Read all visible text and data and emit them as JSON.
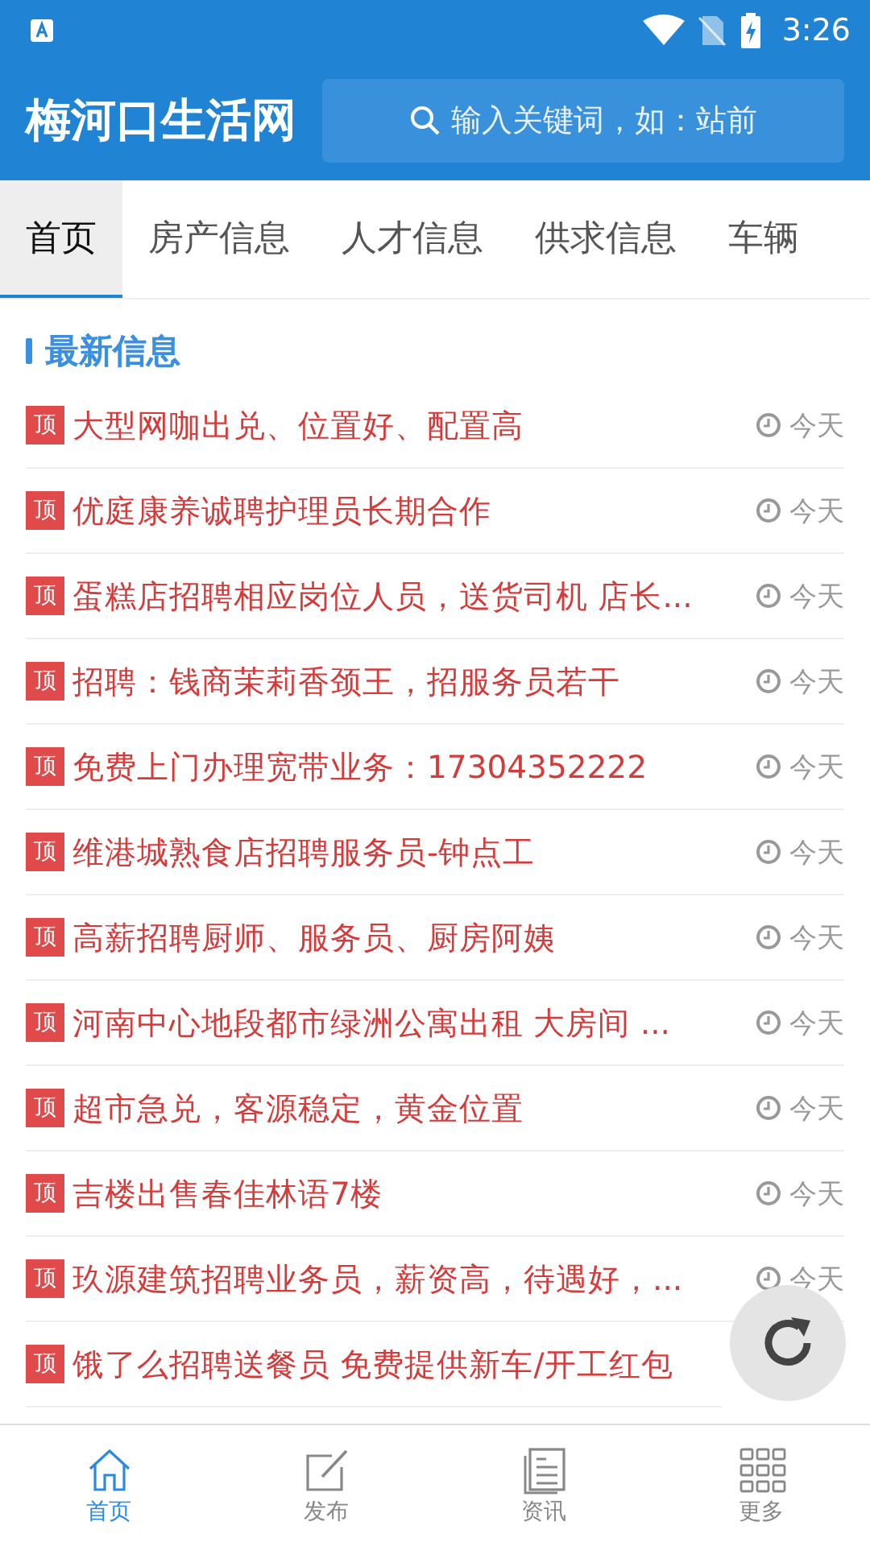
{
  "status_bar": {
    "time": "3:26"
  },
  "header": {
    "logo": "梅河口生活网",
    "search": {
      "placeholder": "输入关键词，如：站前"
    }
  },
  "tabs": [
    {
      "label": "首页",
      "selected": true
    },
    {
      "label": "房产信息",
      "selected": false
    },
    {
      "label": "人才信息",
      "selected": false
    },
    {
      "label": "供求信息",
      "selected": false
    },
    {
      "label": "车辆",
      "selected": false
    }
  ],
  "section": {
    "title": "最新信息"
  },
  "items": [
    {
      "badge": "顶",
      "title": "大型网咖出兑、位置好、配置高",
      "time": "今天"
    },
    {
      "badge": "顶",
      "title": "优庭康养诚聘护理员长期合作",
      "time": "今天"
    },
    {
      "badge": "顶",
      "title": "蛋糕店招聘相应岗位人员，送货司机 店长...",
      "time": "今天"
    },
    {
      "badge": "顶",
      "title": "招聘：钱商茉莉香颈王，招服务员若干",
      "time": "今天"
    },
    {
      "badge": "顶",
      "title": "免费上门办理宽带业务：17304352222",
      "time": "今天"
    },
    {
      "badge": "顶",
      "title": "维港城熟食店招聘服务员-钟点工",
      "time": "今天"
    },
    {
      "badge": "顶",
      "title": "高薪招聘厨师、服务员、厨房阿姨",
      "time": "今天"
    },
    {
      "badge": "顶",
      "title": "河南中心地段都市绿洲公寓出租 大房间 ...",
      "time": "今天"
    },
    {
      "badge": "顶",
      "title": "超市急兑，客源稳定，黄金位置",
      "time": "今天"
    },
    {
      "badge": "顶",
      "title": "吉楼出售春佳林语7楼",
      "time": "今天"
    },
    {
      "badge": "顶",
      "title": "玖源建筑招聘业务员，薪资高，待遇好，...",
      "time": "今天"
    },
    {
      "badge": "顶",
      "title": "饿了么招聘送餐员 免费提供新车/开工红包"
    }
  ],
  "bottom_nav": [
    {
      "label": "首页",
      "kind": "home",
      "selected": true
    },
    {
      "label": "发布",
      "kind": "post",
      "selected": false
    },
    {
      "label": "资讯",
      "kind": "news",
      "selected": false
    },
    {
      "label": "更多",
      "kind": "more",
      "selected": false
    }
  ]
}
